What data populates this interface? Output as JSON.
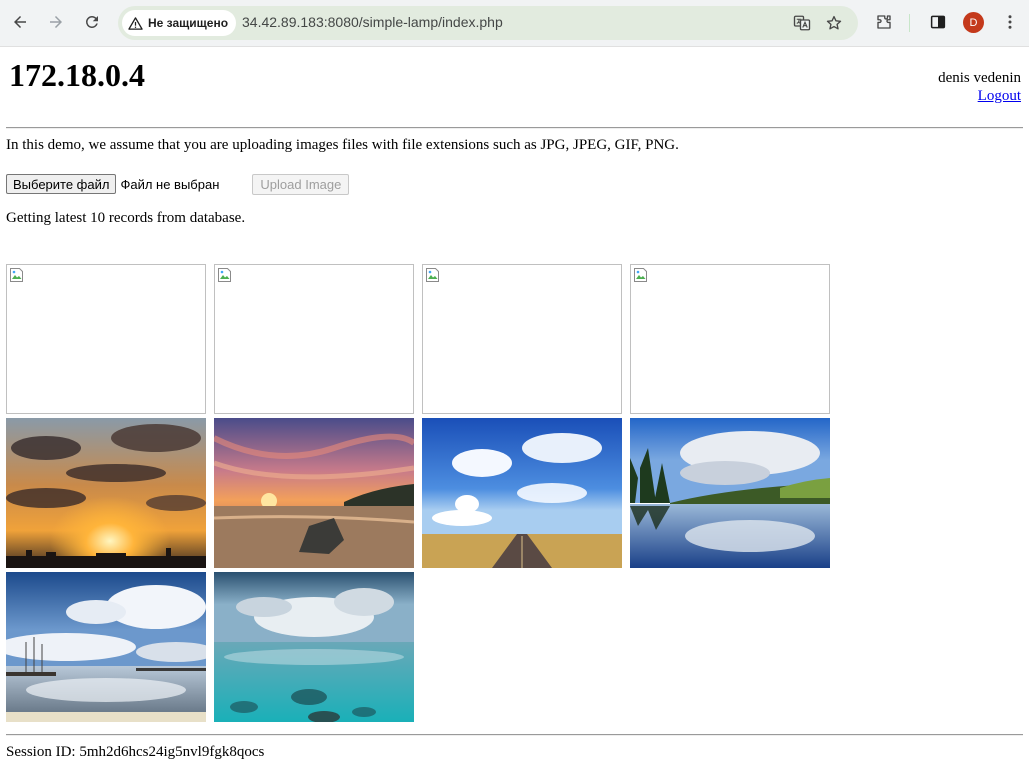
{
  "browser": {
    "security_label": "Не защищено",
    "url": "34.42.89.183:8080/simple-lamp/index.php",
    "profile_initial": "D"
  },
  "header": {
    "host": "172.18.0.4",
    "user_name": "denis vedenin",
    "logout_label": "Logout"
  },
  "intro_text": "In this demo, we assume that you are uploading images files with file extensions such as JPG, JPEG, GIF, PNG.",
  "upload": {
    "choose_file_label": "Выберите файл",
    "file_status": "Файл не выбран",
    "upload_label": "Upload Image"
  },
  "records_text": "Getting latest 10 records from database.",
  "gallery": {
    "images": [
      {
        "state": "broken"
      },
      {
        "state": "broken"
      },
      {
        "state": "broken"
      },
      {
        "state": "broken"
      },
      {
        "state": "loaded",
        "subject": "sunset clouds over city skyline"
      },
      {
        "state": "loaded",
        "subject": "sunset beach with rock"
      },
      {
        "state": "loaded",
        "subject": "road through wheat field under blue sky"
      },
      {
        "state": "loaded",
        "subject": "lake reflecting clouds and forest"
      },
      {
        "state": "loaded",
        "subject": "dramatic clouds over harbor"
      },
      {
        "state": "loaded",
        "subject": "turquoise sea under clouds"
      }
    ]
  },
  "session": {
    "text": "Session ID: 5mh2d6hcs24ig5nvl9fgk8qocs"
  }
}
